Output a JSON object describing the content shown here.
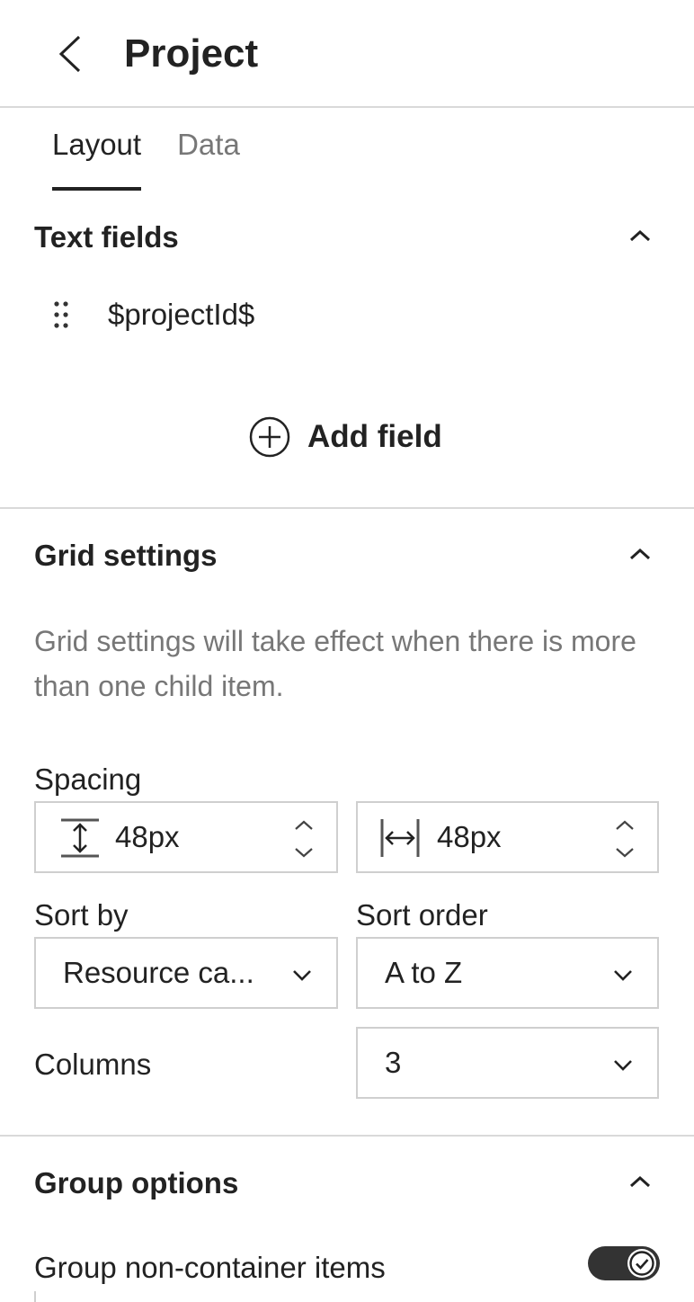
{
  "header": {
    "title": "Project"
  },
  "tabs": [
    {
      "label": "Layout",
      "active": true
    },
    {
      "label": "Data",
      "active": false
    }
  ],
  "text_fields": {
    "title": "Text fields",
    "items": [
      {
        "label": "$projectId$"
      }
    ],
    "add_label": "Add field"
  },
  "grid_settings": {
    "title": "Grid settings",
    "help": "Grid settings will take effect when there is more than one child item.",
    "spacing": {
      "label": "Spacing",
      "vertical": "48px",
      "horizontal": "48px"
    },
    "sort_by": {
      "label": "Sort by",
      "value": "Resource ca..."
    },
    "sort_order": {
      "label": "Sort order",
      "value": "A to Z"
    },
    "columns": {
      "label": "Columns",
      "value": "3"
    }
  },
  "group_options": {
    "title": "Group options",
    "group_non_container": {
      "label": "Group non-container items",
      "enabled": true
    }
  },
  "colors": {
    "text": "#222222",
    "muted": "#777777",
    "border": "#cfcfcf",
    "toggle_on": "#333333"
  }
}
